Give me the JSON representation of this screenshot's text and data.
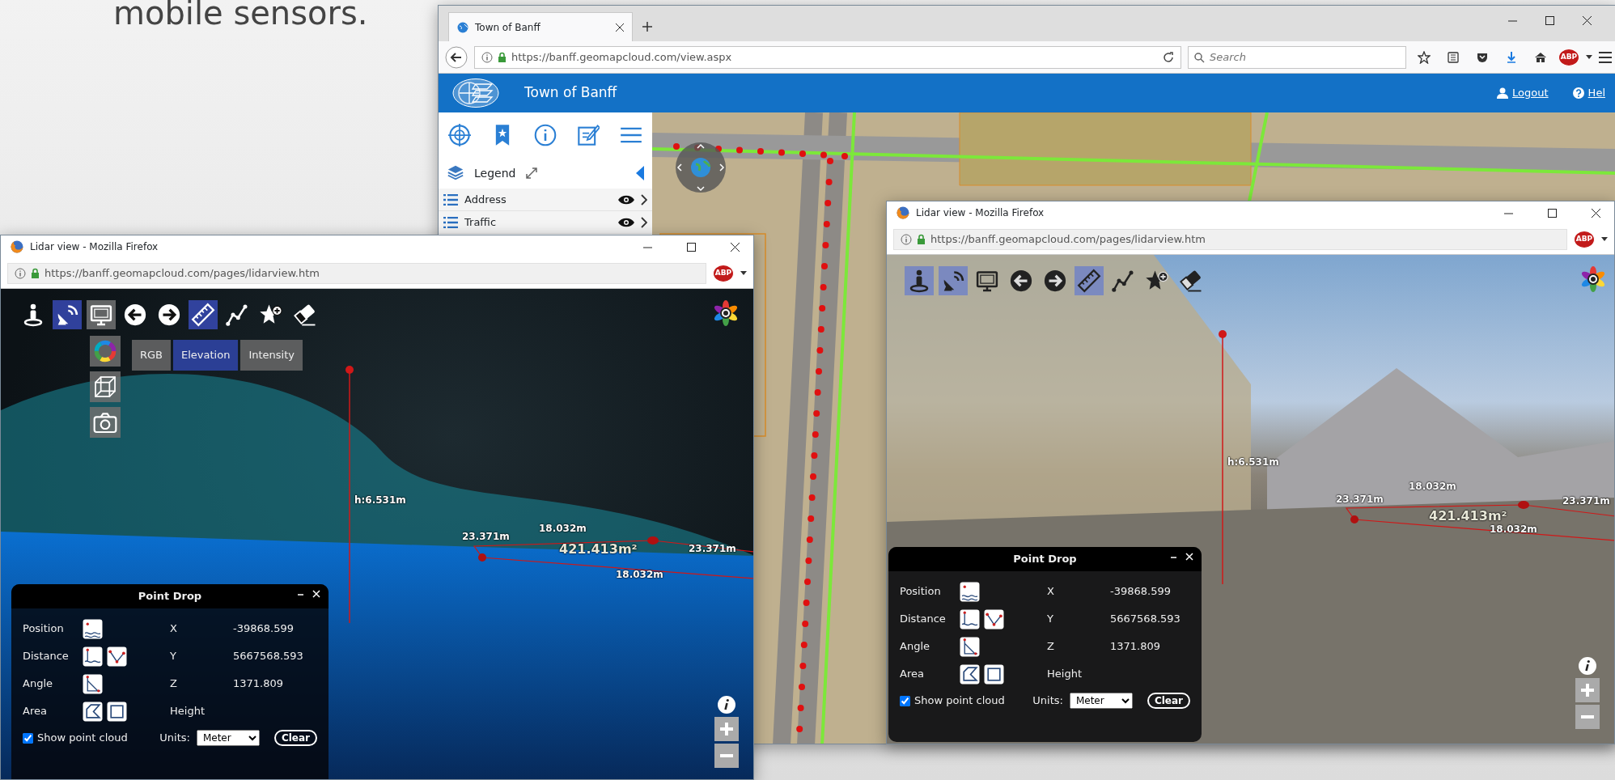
{
  "slide_text": "mobile sensors.",
  "main_window": {
    "tabs": [
      {
        "label": "Town of Banff",
        "selected": true
      }
    ],
    "url": "https://banff.geomapcloud.com/view.aspx",
    "search": {
      "placeholder": "Search"
    },
    "adblock_badge": "ABP",
    "app_title": "Town of Banff",
    "header_links": [
      "Logout",
      "Hel"
    ],
    "legend_title": "Legend",
    "layers": [
      {
        "name": "Address"
      },
      {
        "name": "Traffic"
      }
    ]
  },
  "lidar_windows": [
    {
      "title": "Lidar view - Mozilla Firefox",
      "url": "https://banff.geomapcloud.com/pages/lidarview.htm",
      "adblock_badge": "ABP",
      "kind": "point_cloud",
      "toolbar": [
        {
          "kind": "walk",
          "selected": false
        },
        {
          "kind": "satellite",
          "selected": true
        },
        {
          "kind": "display",
          "selected": true
        },
        {
          "kind": "back",
          "selected": false
        },
        {
          "kind": "forward",
          "selected": false
        },
        {
          "kind": "ruler",
          "selected": true
        },
        {
          "kind": "path",
          "selected": false
        },
        {
          "kind": "star",
          "selected": false
        },
        {
          "kind": "eraser",
          "selected": false
        }
      ],
      "side_menu": [
        {
          "kind": "color_wheel"
        },
        {
          "kind": "cube"
        },
        {
          "kind": "camera"
        }
      ],
      "color_modes": [
        {
          "label": "RGB",
          "selected": false
        },
        {
          "label": "Elevation",
          "selected": true
        },
        {
          "label": "Intensity",
          "selected": false
        }
      ],
      "measurements": [
        {
          "kind": "height",
          "text": "h:6.531m"
        },
        {
          "kind": "length",
          "text": "23.371m"
        },
        {
          "kind": "length",
          "text": "18.032m"
        },
        {
          "kind": "area",
          "text": "421.413m²"
        },
        {
          "kind": "length",
          "text": "23.371m"
        },
        {
          "kind": "length",
          "text": "18.032m"
        }
      ],
      "point_drop": {
        "title": "Point Drop",
        "tools": [
          {
            "label": "Position",
            "icons": [
              {
                "kind": "position"
              }
            ]
          },
          {
            "label": "Distance",
            "icons": [
              {
                "kind": "vertical"
              },
              {
                "kind": "segment"
              }
            ]
          },
          {
            "label": "Angle",
            "icons": [
              {
                "kind": "angle"
              }
            ]
          },
          {
            "label": "Area",
            "icons": [
              {
                "kind": "polygon"
              },
              {
                "kind": "rectangle"
              }
            ]
          }
        ],
        "coords": [
          {
            "label": "X",
            "value": "-39868.599"
          },
          {
            "label": "Y",
            "value": "5667568.593"
          },
          {
            "label": "Z",
            "value": "1371.809"
          },
          {
            "label": "Height"
          }
        ],
        "show_point_cloud": {
          "label": "Show point cloud",
          "checked": true
        },
        "units_label": "Units:",
        "units": "Meter",
        "clear": "Clear"
      }
    },
    {
      "title": "Lidar view - Mozilla Firefox",
      "url": "https://banff.geomapcloud.com/pages/lidarview.htm",
      "adblock_badge": "ABP",
      "kind": "photo",
      "toolbar": [
        {
          "kind": "walk",
          "selected": true
        },
        {
          "kind": "satellite",
          "selected": true
        },
        {
          "kind": "display",
          "selected": false
        },
        {
          "kind": "back",
          "selected": false
        },
        {
          "kind": "forward",
          "selected": false
        },
        {
          "kind": "ruler",
          "selected": true
        },
        {
          "kind": "path",
          "selected": false
        },
        {
          "kind": "star",
          "selected": false
        },
        {
          "kind": "eraser",
          "selected": false
        }
      ],
      "measurements": [
        {
          "kind": "height",
          "text": "h:6.531m"
        },
        {
          "kind": "length",
          "text": "23.371m"
        },
        {
          "kind": "length",
          "text": "18.032m"
        },
        {
          "kind": "area",
          "text": "421.413m²"
        },
        {
          "kind": "length",
          "text": "23.371m"
        },
        {
          "kind": "length",
          "text": "18.032m"
        }
      ],
      "point_drop": {
        "title": "Point Drop",
        "tools": [
          {
            "label": "Position",
            "icons": [
              {
                "kind": "position"
              }
            ]
          },
          {
            "label": "Distance",
            "icons": [
              {
                "kind": "vertical"
              },
              {
                "kind": "segment"
              }
            ]
          },
          {
            "label": "Angle",
            "icons": [
              {
                "kind": "angle"
              }
            ]
          },
          {
            "label": "Area",
            "icons": [
              {
                "kind": "polygon"
              },
              {
                "kind": "rectangle"
              }
            ]
          }
        ],
        "coords": [
          {
            "label": "X",
            "value": "-39868.599"
          },
          {
            "label": "Y",
            "value": "5667568.593"
          },
          {
            "label": "Z",
            "value": "1371.809"
          },
          {
            "label": "Height"
          }
        ],
        "show_point_cloud": {
          "label": "Show point cloud",
          "checked": true
        },
        "units_label": "Units:",
        "units": "Meter",
        "clear": "Clear"
      }
    }
  ]
}
